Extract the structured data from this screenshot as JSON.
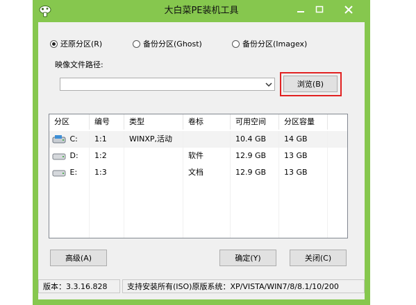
{
  "window": {
    "title": "大白菜PE装机工具"
  },
  "modes": [
    {
      "label": "还原分区(R)",
      "selected": true
    },
    {
      "label": "备份分区(Ghost)",
      "selected": false
    },
    {
      "label": "备份分区(Imagex)",
      "selected": false
    }
  ],
  "image_path": {
    "label": "映像文件路径:",
    "value": ""
  },
  "buttons": {
    "browse": "浏览(B)",
    "advanced": "高级(A)",
    "ok": "确定(Y)",
    "close": "关闭(C)"
  },
  "table": {
    "columns": [
      "分区",
      "编号",
      "类型",
      "卷标",
      "可用空间",
      "分区容量"
    ],
    "rows": [
      {
        "drive": "C:",
        "number": "1:1",
        "type": "WINXP,活动",
        "label": "",
        "free": "10.4 GB",
        "size": "14 GB",
        "selected": true
      },
      {
        "drive": "D:",
        "number": "1:2",
        "type": "",
        "label": "软件",
        "free": "12.9 GB",
        "size": "13 GB",
        "selected": false
      },
      {
        "drive": "E:",
        "number": "1:3",
        "type": "",
        "label": "文档",
        "free": "12.9 GB",
        "size": "13 GB",
        "selected": false
      }
    ]
  },
  "status": {
    "version": "版本：3.3.16.828",
    "support": "支持安装所有(ISO)原版系统：XP/VISTA/WIN7/8/8.1/10/200"
  },
  "colors": {
    "frame": "#86c74e",
    "highlight": "#e12121"
  }
}
